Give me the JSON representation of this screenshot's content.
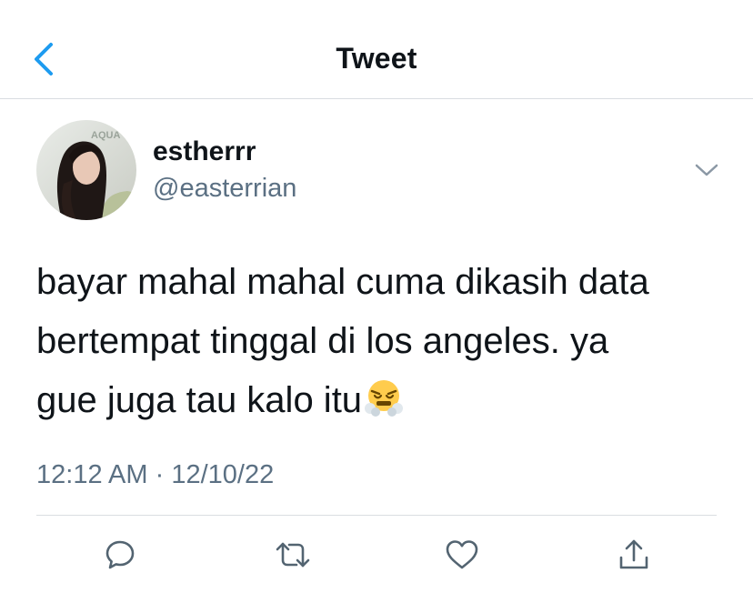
{
  "header": {
    "title": "Tweet",
    "back_icon": "chevron-left-icon",
    "accent_color": "#1d9bf0"
  },
  "author": {
    "display_name": "estherrr",
    "handle": "@easterrian",
    "avatar_text": "AQUA"
  },
  "tweet": {
    "text_lines": [
      "bayar mahal mahal cuma dikasih data",
      "bertempat tinggal di los angeles. ya",
      "gue juga tau kalo itu"
    ],
    "emoji": "face-with-steam-from-nose",
    "time": "12:12 AM",
    "separator": "·",
    "date": "12/10/22"
  },
  "actions": [
    "reply-icon",
    "retweet-icon",
    "like-icon",
    "share-icon"
  ],
  "colors": {
    "secondary_text": "#5b7083",
    "divider": "#d9dde1",
    "icon": "#536471"
  }
}
